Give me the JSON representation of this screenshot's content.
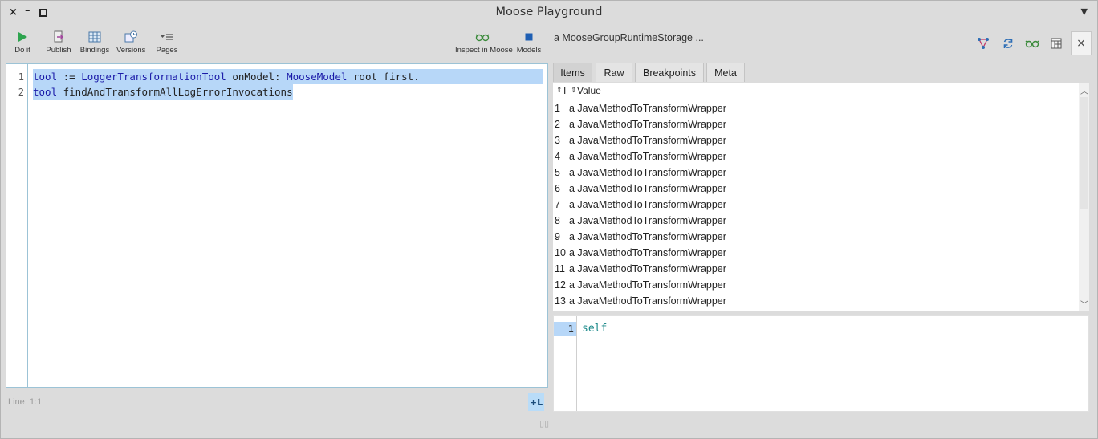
{
  "window": {
    "title": "Moose Playground",
    "controls": {
      "close": "×",
      "minimize": "–",
      "menu": "▼"
    }
  },
  "toolbar": {
    "do_it": "Do it",
    "publish": "Publish",
    "bindings": "Bindings",
    "versions": "Versions",
    "pages": "Pages",
    "inspect_in_moose": "Inspect in Moose",
    "models": "Models"
  },
  "editor": {
    "line_numbers": [
      "1",
      "2"
    ],
    "line1": {
      "var": "tool",
      "assign": " := ",
      "cls1": "LoggerTransformationTool",
      "msg1": " onModel: ",
      "cls2": "MooseModel",
      "msg2": " root first."
    },
    "line2": {
      "var": "tool",
      "msg": " findAndTransformAllLogErrorInvocations"
    },
    "status": "Line: 1:1",
    "add_line_button": "+L"
  },
  "inspector": {
    "title": "a MooseGroupRuntimeStorage ...",
    "close_label": "×",
    "tabs": [
      "Items",
      "Raw",
      "Breakpoints",
      "Meta"
    ],
    "active_tab": "Items",
    "columns": {
      "index": "I",
      "value": "Value"
    },
    "rows": [
      {
        "index": "1",
        "value": "a JavaMethodToTransformWrapper"
      },
      {
        "index": "2",
        "value": "a JavaMethodToTransformWrapper"
      },
      {
        "index": "3",
        "value": "a JavaMethodToTransformWrapper"
      },
      {
        "index": "4",
        "value": "a JavaMethodToTransformWrapper"
      },
      {
        "index": "5",
        "value": "a JavaMethodToTransformWrapper"
      },
      {
        "index": "6",
        "value": "a JavaMethodToTransformWrapper"
      },
      {
        "index": "7",
        "value": "a JavaMethodToTransformWrapper"
      },
      {
        "index": "8",
        "value": "a JavaMethodToTransformWrapper"
      },
      {
        "index": "9",
        "value": "a JavaMethodToTransformWrapper"
      },
      {
        "index": "10",
        "value": "a JavaMethodToTransformWrapper"
      },
      {
        "index": "11",
        "value": "a JavaMethodToTransformWrapper"
      },
      {
        "index": "12",
        "value": "a JavaMethodToTransformWrapper"
      },
      {
        "index": "13",
        "value": "a JavaMethodToTransformWrapper"
      }
    ],
    "evaluator": {
      "line_number": "1",
      "code": "self"
    }
  },
  "colors": {
    "accent_selection": "#b7d7f8",
    "play_green": "#2ea44f",
    "code_blue": "#1a1aa8",
    "self_teal": "#1c8a8a"
  }
}
